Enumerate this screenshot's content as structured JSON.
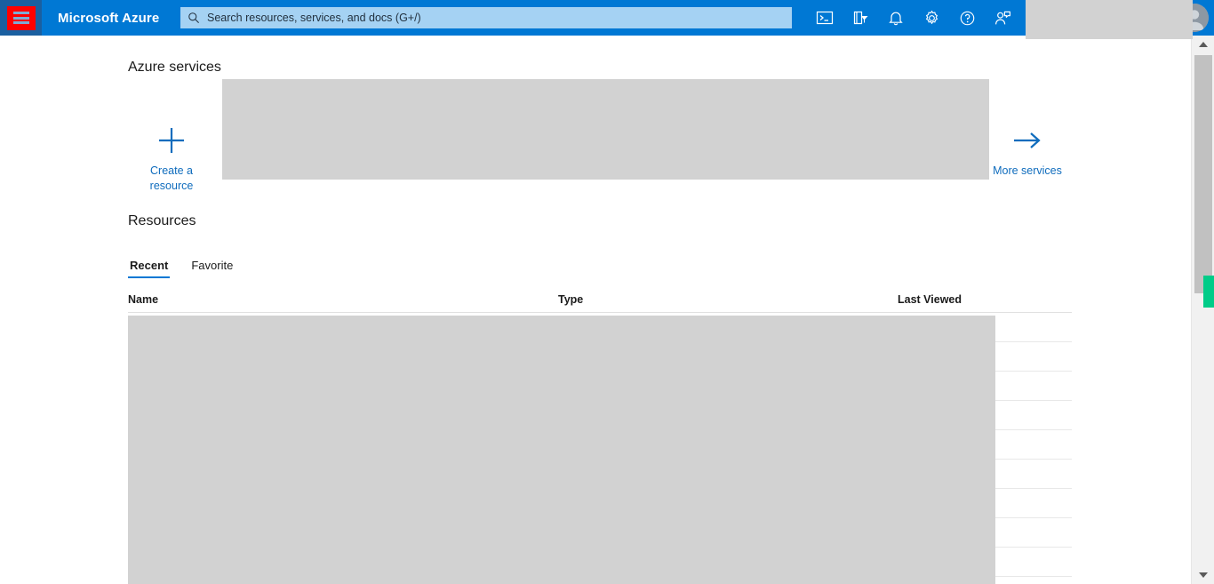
{
  "header": {
    "menu_button_name": "Show portal menu",
    "brand": "Microsoft Azure",
    "search": {
      "placeholder": "Search resources, services, and docs (G+/)",
      "value": "",
      "icon": "search-icon"
    },
    "icons": [
      {
        "name": "cloud-shell-icon",
        "label": "Cloud Shell"
      },
      {
        "name": "directories-subscriptions-icon",
        "label": "Directories + subscriptions"
      },
      {
        "name": "notifications-bell-icon",
        "label": "Notifications"
      },
      {
        "name": "settings-gear-icon",
        "label": "Settings"
      },
      {
        "name": "help-question-icon",
        "label": "Help"
      },
      {
        "name": "feedback-person-icon",
        "label": "Feedback"
      }
    ],
    "account": {
      "avatar_icon": "user-avatar-icon",
      "name": "",
      "redacted": true
    }
  },
  "azure_services": {
    "title": "Azure services",
    "create_resource": {
      "label": "Create a resource",
      "icon": "plus-icon"
    },
    "more_services": {
      "label": "More services",
      "icon": "arrow-right-icon"
    },
    "redacted_tiles": true
  },
  "resources": {
    "title": "Resources",
    "tabs": [
      {
        "label": "Recent",
        "active": true
      },
      {
        "label": "Favorite",
        "active": false
      }
    ],
    "columns": [
      {
        "label": "Name"
      },
      {
        "label": "Type"
      },
      {
        "label": "Last Viewed"
      }
    ],
    "rows": [],
    "row_count": 9,
    "redacted": true
  },
  "scrollbar": {
    "up_arrow": "scroll-up-arrow-icon",
    "down_arrow": "scroll-down-arrow-icon",
    "marker_color": "#00cc88"
  },
  "colors": {
    "azure_blue": "#0078d4",
    "menu_panel_blue": "#1a5fa0",
    "focus_red": "#ff0000",
    "link_blue": "#0f6cbd",
    "search_field": "#a5d2f3",
    "redaction_grey": "#d2d2d2",
    "accent_green": "#00cc88"
  }
}
